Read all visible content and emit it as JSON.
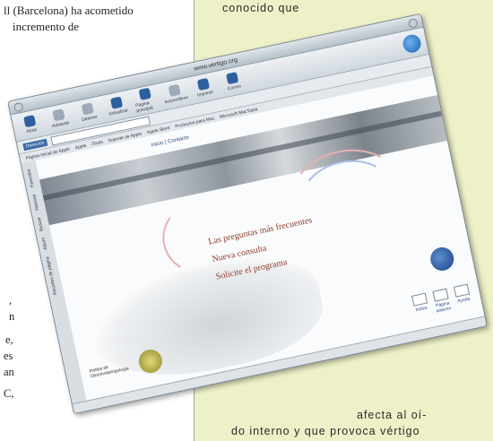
{
  "magazine": {
    "left_lines": [
      "ll (Barcelona) ha acometido",
      "incremento de"
    ],
    "left_margin": [
      ",",
      "n",
      "e,",
      "es",
      "an",
      "C,"
    ],
    "right_top": "conocido que",
    "right_bottom": [
      "afecta al oí-",
      "do interno y que provoca vértigo"
    ]
  },
  "browser": {
    "title": "www.vertigo.org",
    "toolbar": [
      "Atrás",
      "Adelante",
      "Detener",
      "Actualizar",
      "Página principal",
      "Autorrelleno",
      "Imprimir",
      "Correo"
    ],
    "address_label": "Dirección",
    "links": [
      "Página inicial de Apple",
      "Apple",
      "iTools",
      "Soporte de Apple",
      "Apple Store",
      "Productos para Mac",
      "Microsoft MacTopia"
    ],
    "side_tabs": [
      "Favoritos",
      "Historial",
      "Buscar",
      "Álbum",
      "Recortes de página"
    ],
    "top_links": "Inicio | Contacto",
    "menu": [
      "Las preguntas más frecuentes",
      "Nueva consulta",
      "Solicite el programa"
    ],
    "institute": "Institut de Otorrinolaringologia",
    "nav": [
      "Índice",
      "Página anterior",
      "Ayuda"
    ]
  },
  "colors": {
    "menu_link": "#8a3a2a",
    "right_column": "#eef1c8",
    "accent_blue": "#2c5f9e"
  }
}
